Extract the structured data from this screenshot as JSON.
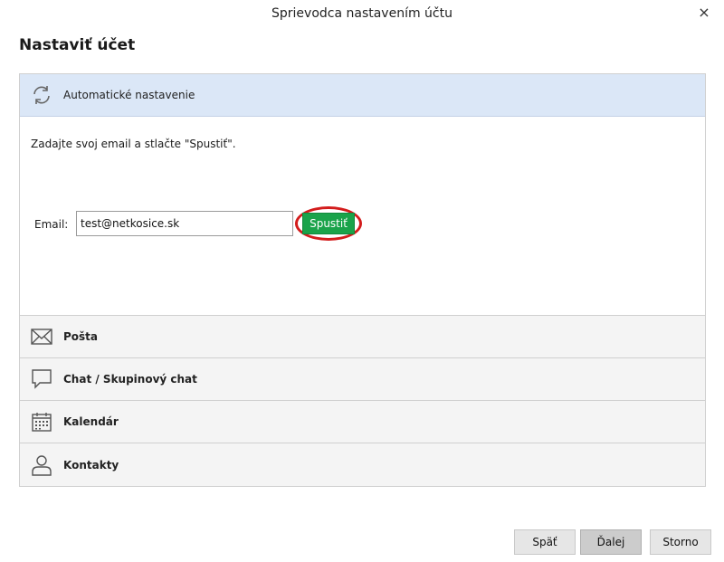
{
  "window": {
    "title": "Sprievodca nastavením účtu",
    "close_glyph": "×"
  },
  "page": {
    "heading": "Nastaviť účet"
  },
  "auto_setup": {
    "label": "Automatické nastavenie",
    "icon": "refresh-icon",
    "instruction": "Zadajte svoj email a stlačte \"Spustiť\".",
    "email_label": "Email:",
    "email_value": "test@netkosice.sk",
    "run_label": "Spustiť",
    "highlight_color": "#d31c1c",
    "run_color": "#1aa34a"
  },
  "sections": [
    {
      "label": "Pošta",
      "icon": "envelope-icon"
    },
    {
      "label": "Chat / Skupinový chat",
      "icon": "chat-bubble-icon"
    },
    {
      "label": "Kalendár",
      "icon": "calendar-icon"
    },
    {
      "label": "Kontakty",
      "icon": "person-icon"
    }
  ],
  "footer": {
    "back_label": "Späť",
    "next_label": "Ďalej",
    "cancel_label": "Storno"
  },
  "colors": {
    "active_header": "#dbe7f7"
  }
}
